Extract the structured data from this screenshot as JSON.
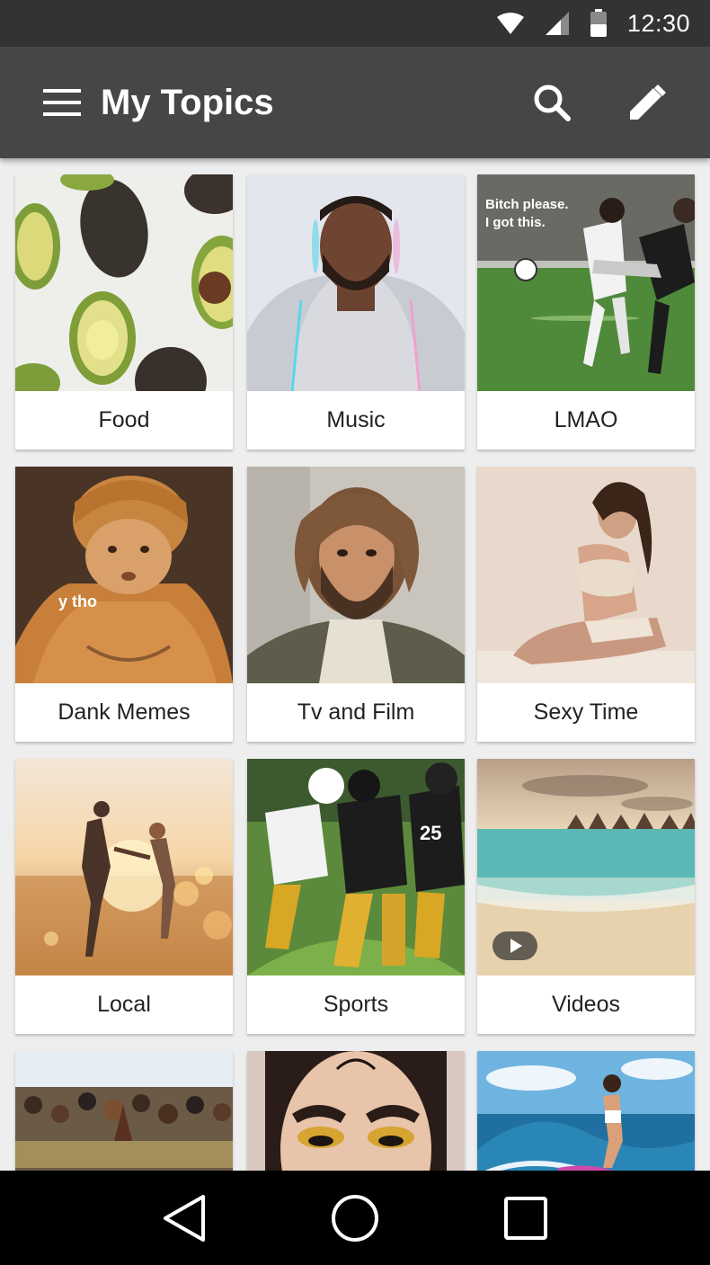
{
  "status_bar": {
    "time": "12:30",
    "icons": [
      "wifi-icon",
      "signal-icon",
      "battery-icon"
    ]
  },
  "app_bar": {
    "title": "My Topics",
    "menu_icon": "hamburger-menu-icon",
    "actions": [
      "search-icon",
      "edit-pencil-icon"
    ]
  },
  "topics": [
    {
      "label": "Food",
      "image": "avocados"
    },
    {
      "label": "Music",
      "image": "man-in-hoodie-portrait"
    },
    {
      "label": "LMAO",
      "image": "soccer-players",
      "overlay_text": "Bitch please.\nI got this."
    },
    {
      "label": "Dank Memes",
      "image": "painted-baby",
      "overlay_text": "y tho"
    },
    {
      "label": "Tv and Film",
      "image": "bearded-man-portrait"
    },
    {
      "label": "Sexy Time",
      "image": "woman-posing"
    },
    {
      "label": "Local",
      "image": "couple-running-sunset"
    },
    {
      "label": "Sports",
      "image": "football-players"
    },
    {
      "label": "Videos",
      "image": "tropical-beach",
      "play_icon": "play-icon"
    },
    {
      "label": "",
      "image": "crowd"
    },
    {
      "label": "",
      "image": "woman-gold-eyeshadow"
    },
    {
      "label": "",
      "image": "surfer"
    }
  ],
  "nav_bar": {
    "buttons": [
      "back-triangle-icon",
      "home-circle-icon",
      "recents-square-icon"
    ]
  },
  "colors": {
    "status_bar_bg": "#333333",
    "app_bar_bg": "#464646",
    "page_bg": "#eeeeee",
    "card_bg": "#ffffff",
    "nav_bar_bg": "#000000"
  }
}
